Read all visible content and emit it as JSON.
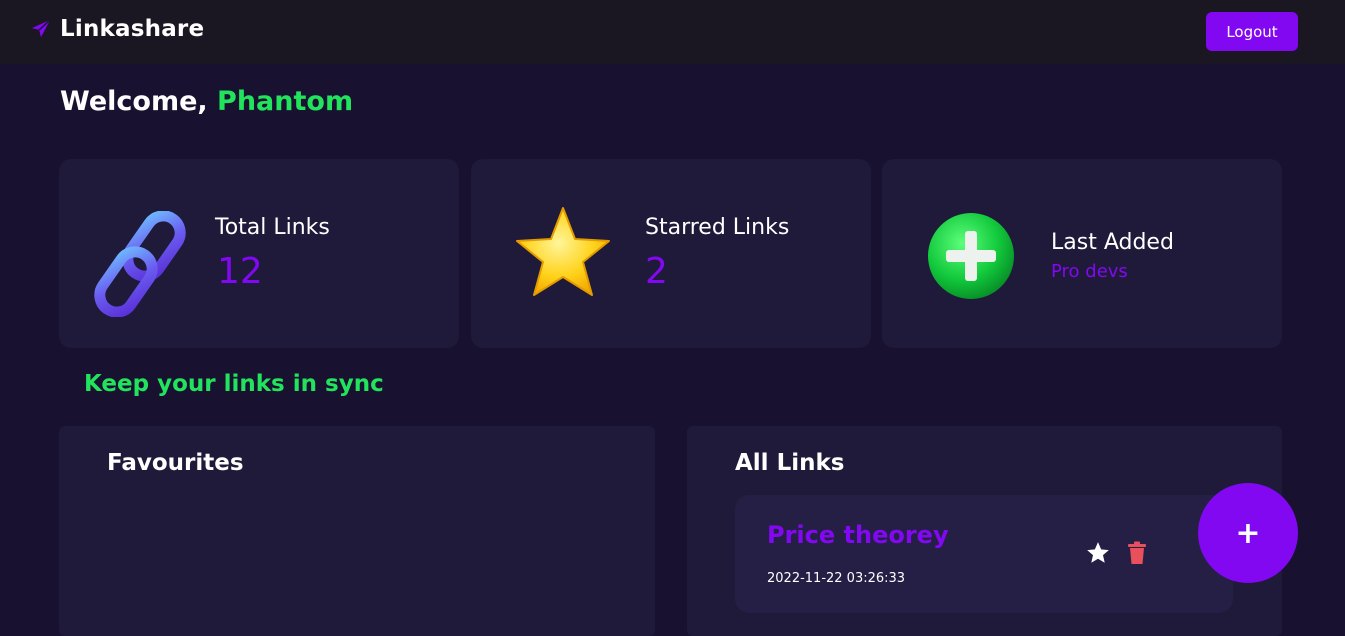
{
  "navbar": {
    "brand": "Linkashare",
    "logout_label": "Logout"
  },
  "welcome": {
    "greeting": "Welcome, ",
    "username": "Phantom"
  },
  "stats": {
    "total": {
      "title": "Total Links",
      "value": "12",
      "icon": "chain-link-icon"
    },
    "starred": {
      "title": "Starred Links",
      "value": "2",
      "icon": "star-icon"
    },
    "last_added": {
      "title": "Last Added",
      "value": "Pro devs",
      "icon": "plus-circle-icon"
    }
  },
  "tagline": "Keep your links in sync",
  "favourites": {
    "title": "Favourites"
  },
  "all_links": {
    "title": "All Links",
    "items": [
      {
        "title": "Price theorey",
        "date": "2022-11-22 03:26:33"
      }
    ]
  },
  "fab_label": "+",
  "colors": {
    "accent": "#8208f2",
    "green": "#22e35c",
    "background": "#181230",
    "card": "#1f1a3a",
    "danger": "#e8505b"
  }
}
